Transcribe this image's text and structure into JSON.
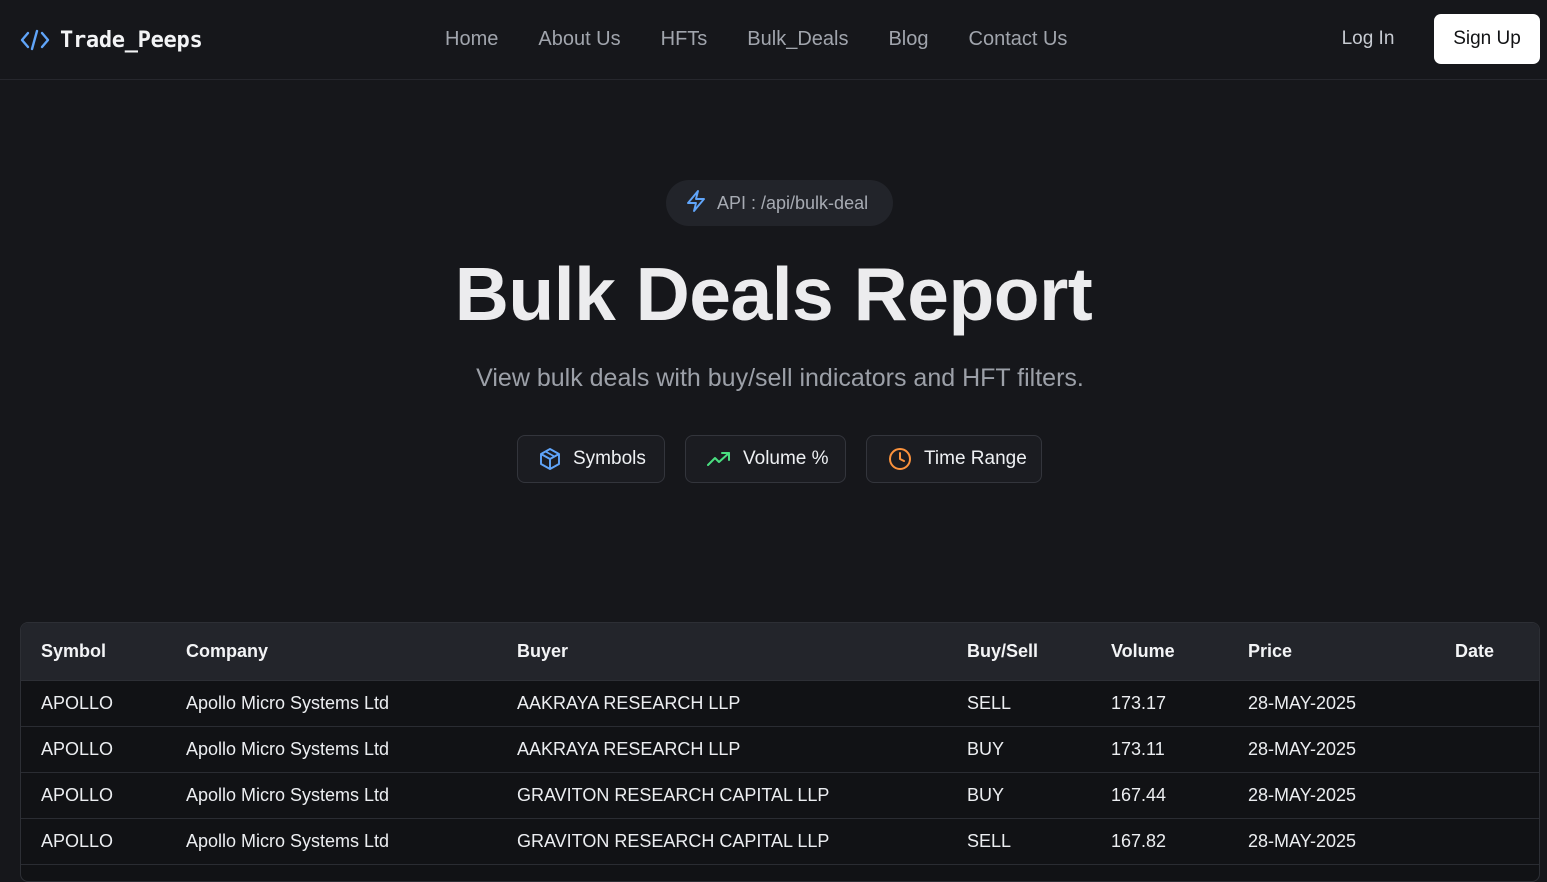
{
  "brand": {
    "name": "Trade_Peeps",
    "icon": "code-brackets-icon",
    "accent": "#60a5fa"
  },
  "nav": {
    "links": [
      "Home",
      "About Us",
      "HFTs",
      "Bulk_Deals",
      "Blog",
      "Contact Us"
    ],
    "login_label": "Log In",
    "signup_label": "Sign Up"
  },
  "hero": {
    "api_badge": "API : /api/bulk-deal",
    "api_icon": "lightning-icon",
    "title": "Bulk Deals Report",
    "subtitle": "View bulk deals with buy/sell indicators and HFT filters."
  },
  "filters": [
    {
      "label": "Symbols",
      "icon": "cube-icon",
      "color": "#60a5fa"
    },
    {
      "label": "Volume %",
      "icon": "trending-up-icon",
      "color": "#4ade80"
    },
    {
      "label": "Time Range",
      "icon": "clock-icon",
      "color": "#fb923c"
    }
  ],
  "table": {
    "columns": [
      "Symbol",
      "Company",
      "Buyer",
      "Buy/Sell",
      "Volume",
      "Price",
      "Date"
    ],
    "rows": [
      [
        "APOLLO",
        "Apollo Micro Systems Ltd",
        "AAKRAYA RESEARCH LLP",
        "SELL",
        "173.17",
        "28-MAY-2025",
        ""
      ],
      [
        "APOLLO",
        "Apollo Micro Systems Ltd",
        "AAKRAYA RESEARCH LLP",
        "BUY",
        "173.11",
        "28-MAY-2025",
        ""
      ],
      [
        "APOLLO",
        "Apollo Micro Systems Ltd",
        "GRAVITON RESEARCH CAPITAL LLP",
        "BUY",
        "167.44",
        "28-MAY-2025",
        ""
      ],
      [
        "APOLLO",
        "Apollo Micro Systems Ltd",
        "GRAVITON RESEARCH CAPITAL LLP",
        "SELL",
        "167.82",
        "28-MAY-2025",
        ""
      ]
    ]
  }
}
